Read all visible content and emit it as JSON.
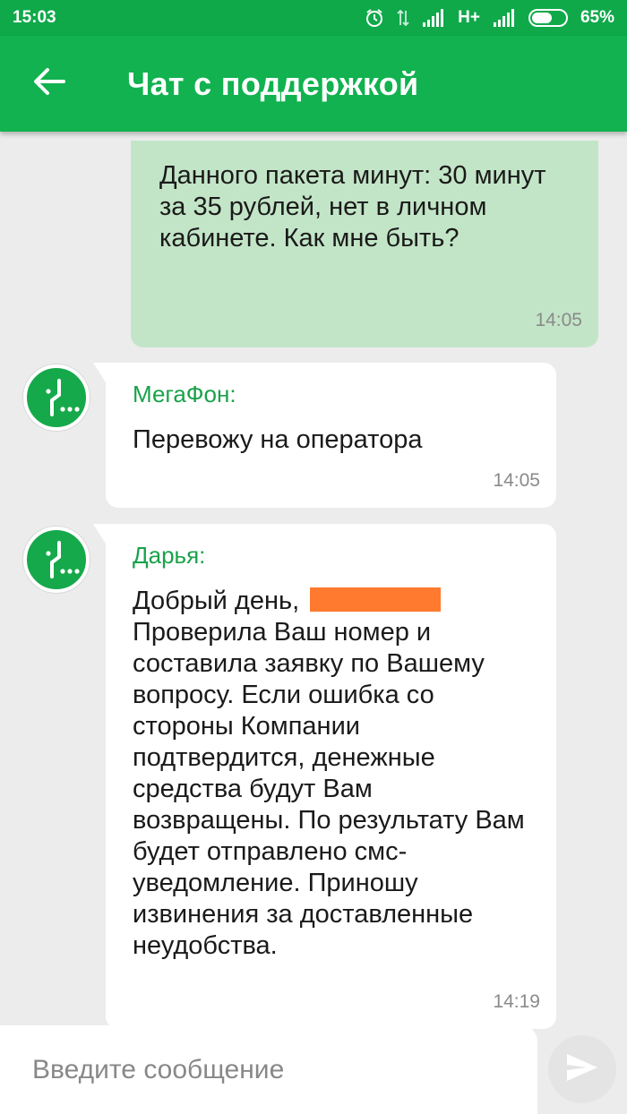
{
  "status_bar": {
    "time": "15:03",
    "network": "H+",
    "battery_percent": "65%",
    "battery_level": 0.65,
    "icons": [
      "alarm-icon",
      "data-arrows-icon",
      "signal-icon",
      "signal-icon",
      "battery-icon"
    ]
  },
  "header": {
    "title": "Чат с поддержкой",
    "back_icon": "arrow-left-icon"
  },
  "messages": [
    {
      "direction": "outgoing",
      "text": "Данного пакета минут: 30 минут за 35 рублей, нет в личном кабинете. Как мне быть?",
      "time": "14:05"
    },
    {
      "direction": "incoming",
      "sender": "МегаФон:",
      "text": "Перевожу на оператора",
      "time": "14:05"
    },
    {
      "direction": "incoming",
      "sender": "Дарья:",
      "text_before_redaction": "Добрый день, ",
      "text_after_redaction": "Проверила Ваш номер и составила заявку по Вашему вопросу. Если ошибка со стороны Компании подтвердится, денежные средства будут Вам возвращены. По результату Вам будет отправлено смс-уведомление. Приношу извинения за доставленные неудобства.",
      "time": "14:19"
    }
  ],
  "composer": {
    "placeholder": "Введите сообщение",
    "send_icon": "send-icon"
  },
  "colors": {
    "status_bar": "#0fa94a",
    "app_bar": "#11b24f",
    "outgoing_bubble": "#c3e5c7",
    "incoming_bubble": "#ffffff",
    "sender_name": "#19a24a",
    "redaction": "#ff7a2e",
    "background": "#ececec"
  }
}
